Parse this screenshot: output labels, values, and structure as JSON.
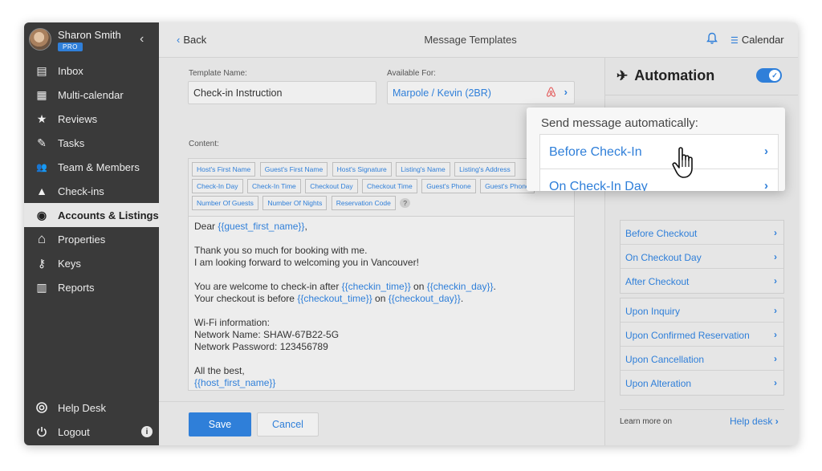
{
  "sidebar": {
    "user_name": "Sharon Smith",
    "plan_badge": "PRO",
    "collapse_glyph": "‹",
    "items": [
      {
        "label": "Inbox",
        "icon": "inbox-icon",
        "glyph": "▤"
      },
      {
        "label": "Multi-calendar",
        "icon": "calendar-grid-icon",
        "glyph": "▦"
      },
      {
        "label": "Reviews",
        "icon": "star-icon",
        "glyph": "★"
      },
      {
        "label": "Tasks",
        "icon": "tasks-icon",
        "glyph": "✎"
      },
      {
        "label": "Team & Members",
        "icon": "team-icon",
        "glyph": "👥"
      },
      {
        "label": "Check-ins",
        "icon": "checkin-icon",
        "glyph": "▲"
      },
      {
        "label": "Accounts & Listings",
        "icon": "account-icon",
        "glyph": "◉"
      },
      {
        "label": "Properties",
        "icon": "home-icon",
        "glyph": "⌂"
      },
      {
        "label": "Keys",
        "icon": "key-icon",
        "glyph": "⚷"
      },
      {
        "label": "Reports",
        "icon": "reports-icon",
        "glyph": "▥"
      }
    ],
    "help_desk": "Help Desk",
    "logout": "Logout",
    "info_glyph": "i"
  },
  "header": {
    "back_label": "Back",
    "title": "Message Templates",
    "calendar_label": "Calendar"
  },
  "form": {
    "template_name_label": "Template Name:",
    "template_name_value": "Check-in Instruction",
    "available_for_label": "Available For:",
    "available_for_value": "Marpole / Kevin (2BR)",
    "content_label": "Content:",
    "tags": [
      "Host's First Name",
      "Guest's First Name",
      "Host's Signature",
      "Listing's Name",
      "Listing's Address",
      "Check-In Day",
      "Check-In Time",
      "Checkout Day",
      "Checkout Time",
      "Guest's Phone",
      "Guest's Phone",
      "Number Of Guests",
      "Number Of Nights",
      "Reservation Code"
    ],
    "tag_help": "?",
    "message": {
      "greeting": "Dear ",
      "greeting_var": "{{guest_first_name}}",
      "greeting_end": ",",
      "thanks_1": "Thank you so much for booking with me.",
      "thanks_2": "I am looking forward to welcoming you in Vancouver!",
      "checkin_pre": "You are welcome to check-in after ",
      "checkin_time_var": "{{checkin_time}}",
      "on_1": " on ",
      "checkin_day_var": "{{checkin_day}}",
      "checkin_end": ".",
      "checkout_pre": "Your checkout is before ",
      "checkout_time_var": "{{checkout_time}}",
      "on_2": " on ",
      "checkout_day_var": "{{checkout_day}}",
      "checkout_end": ".",
      "wifi_title": "Wi-Fi information:",
      "wifi_name": "Network Name: SHAW-67B22-5G",
      "wifi_pass": "Network Password: 123456789",
      "signoff": "All the best,",
      "signoff_var": "{{host_first_name}}"
    },
    "save_label": "Save",
    "cancel_label": "Cancel"
  },
  "automation": {
    "title": "Automation",
    "enabled": true,
    "groups": [
      [
        "Before Checkout",
        "On Checkout Day",
        "After Checkout"
      ],
      [
        "Upon Inquiry",
        "Upon Confirmed Reservation",
        "Upon Cancellation",
        "Upon Alteration"
      ]
    ],
    "learn_more": "Learn more on",
    "help_desk_link": "Help desk"
  },
  "popup": {
    "title": "Send message automatically:",
    "items": [
      "Before Check-In",
      "On Check-In Day"
    ]
  },
  "colors": {
    "accent": "#2f7fd9",
    "sidebar": "#3a3a3a",
    "airbnb": "#e35a5a"
  }
}
